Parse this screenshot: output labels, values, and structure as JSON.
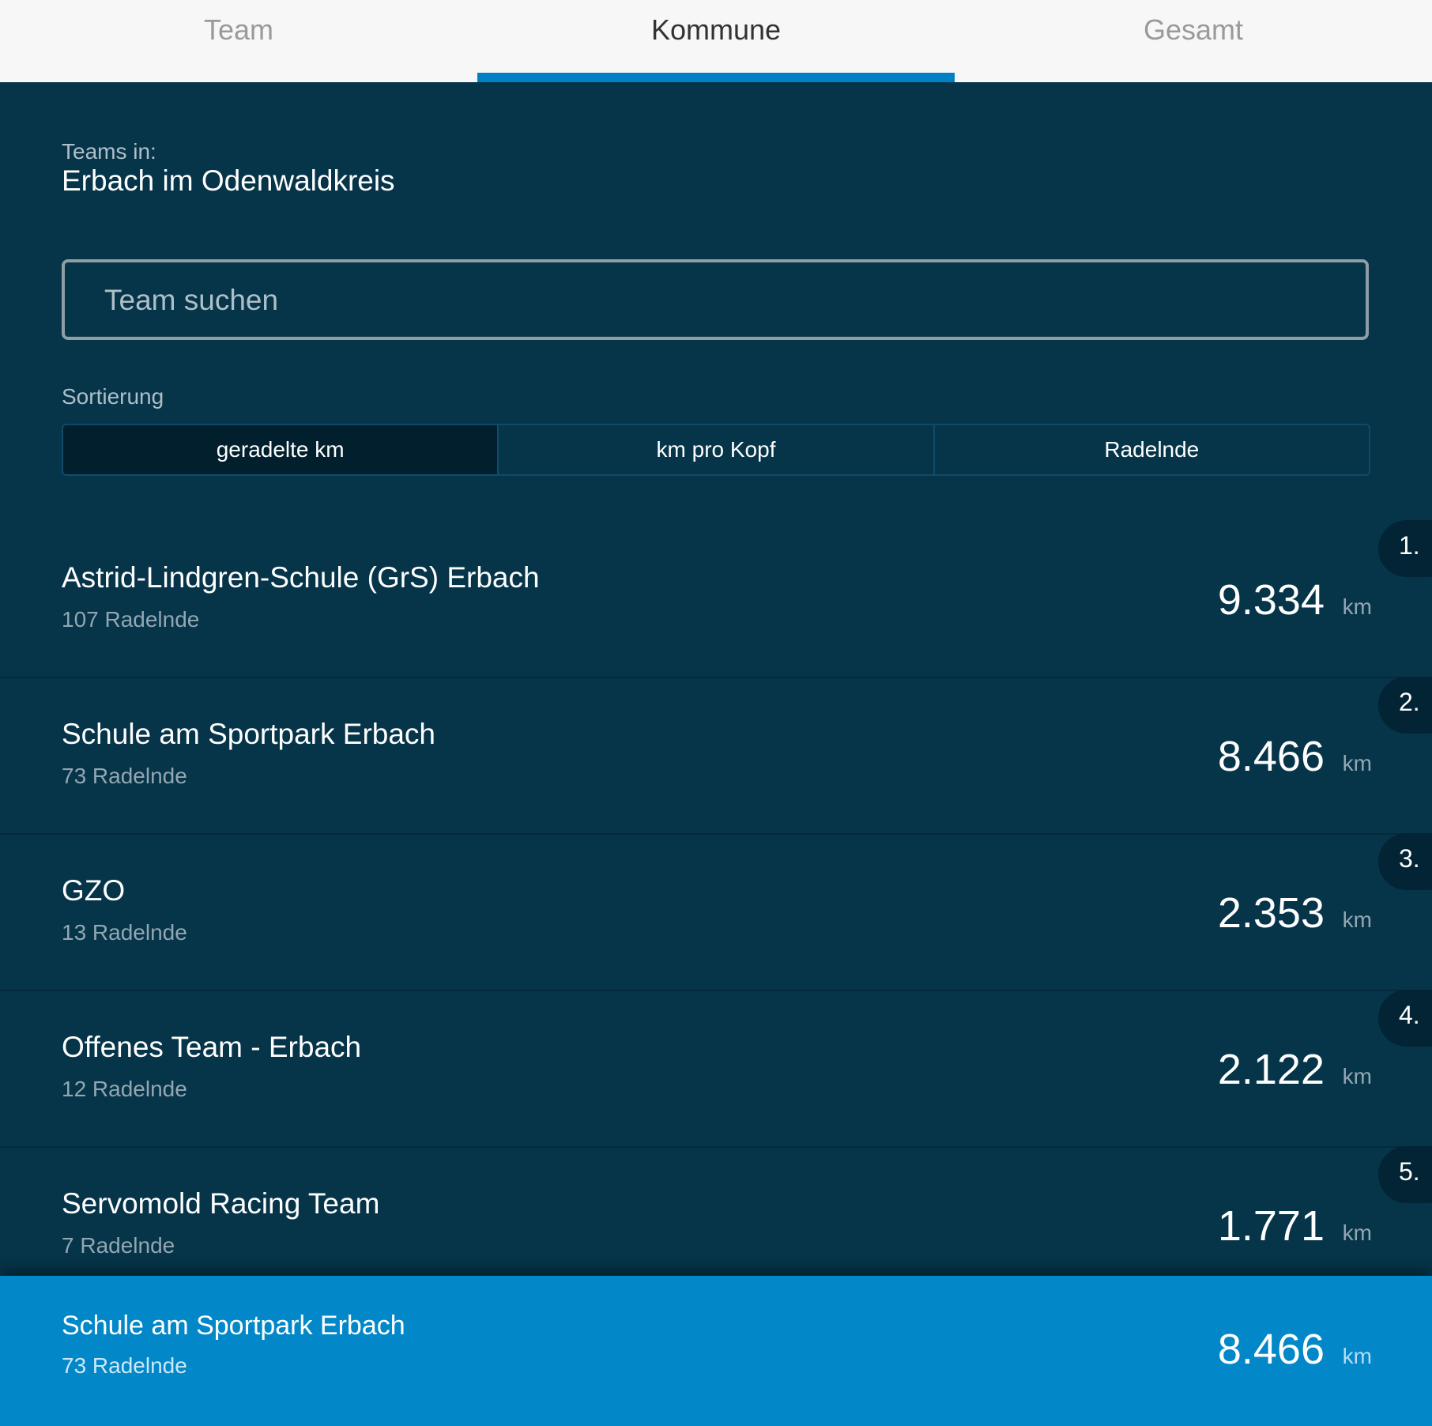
{
  "tabs": [
    {
      "label": "Team",
      "active": false
    },
    {
      "label": "Kommune",
      "active": true
    },
    {
      "label": "Gesamt",
      "active": false
    }
  ],
  "header": {
    "label": "Teams in:",
    "value": "Erbach im Odenwaldkreis"
  },
  "search": {
    "placeholder": "Team suchen",
    "value": ""
  },
  "sort": {
    "label": "Sortierung",
    "options": [
      "geradelte km",
      "km pro Kopf",
      "Radelnde"
    ],
    "selected": "geradelte km"
  },
  "teams": [
    {
      "rank": "1.",
      "name": "Astrid-Lindgren-Schule (GrS) Erbach",
      "members": "107 Radelnde",
      "km": "9.334",
      "unit": "km"
    },
    {
      "rank": "2.",
      "name": "Schule am Sportpark Erbach",
      "members": "73 Radelnde",
      "km": "8.466",
      "unit": "km"
    },
    {
      "rank": "3.",
      "name": "GZO",
      "members": "13 Radelnde",
      "km": "2.353",
      "unit": "km"
    },
    {
      "rank": "4.",
      "name": "Offenes Team - Erbach",
      "members": "12 Radelnde",
      "km": "2.122",
      "unit": "km"
    },
    {
      "rank": "5.",
      "name": "Servomold Racing Team",
      "members": "7 Radelnde",
      "km": "1.771",
      "unit": "km"
    }
  ],
  "own_team": {
    "name": "Schule am Sportpark Erbach",
    "members": "73 Radelnde",
    "km": "8.466",
    "unit": "km"
  },
  "colors": {
    "background": "#063449",
    "accent": "#0280c4",
    "highlight": "#0288c8"
  }
}
